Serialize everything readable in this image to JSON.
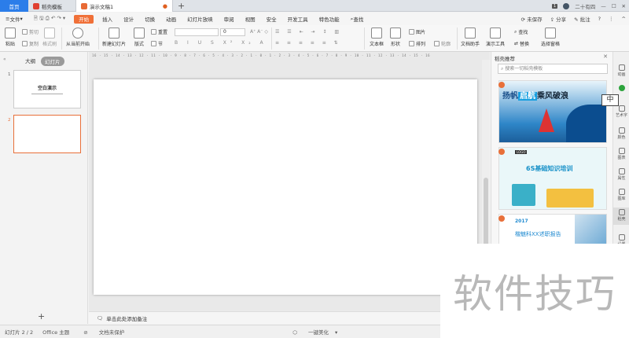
{
  "titlebar": {
    "home": "首页",
    "tab1": "稻壳模板",
    "tab2": "演示文稿1",
    "badge": "1",
    "user": "二十有四",
    "colors": {
      "home": "#2b7de9",
      "active": "#f07038"
    }
  },
  "menubar": {
    "file": "文件",
    "items": [
      "开始",
      "插入",
      "设计",
      "切换",
      "动画",
      "幻灯片放映",
      "审阅",
      "视图",
      "安全",
      "开发工具",
      "特色功能"
    ],
    "search": "查找",
    "unsaved": "未保存",
    "share": "分享",
    "batch": "批注"
  },
  "ribbon": {
    "paste": "粘贴",
    "cut": "剪切",
    "copy": "复制",
    "format": "格式刷",
    "from_start": "从当前开始",
    "new_slide": "新建幻灯片",
    "layout": "版式",
    "reset": "重置",
    "section": "节",
    "font_size": "0",
    "textbox": "文本框",
    "shape": "形状",
    "picture": "图片",
    "arrange": "排列",
    "outline": "轮廓",
    "doc_helper": "文档助手",
    "slide_tools": "演示工具",
    "find": "查找",
    "replace": "替换",
    "select_pane": "选择窗格"
  },
  "leftpanel": {
    "tab_outline": "大纲",
    "tab_slides": "幻灯片",
    "slide1_num": "1",
    "slide1_title": "空白演示",
    "slide2_num": "2",
    "add": "+"
  },
  "canvas": {
    "ruler": "16 · 15 · 14 · 13 · 12 · 11 · 10 · 9 · 8 · 7 · 6 · 5 · 4 · 3 · 2 · 1 · 0 · 1 · 2 · 3 · 4 · 5 · 6 · 7 · 8 · 9 · 10 · 11 · 12 · 13 · 14 · 15 · 16",
    "notes": "单击此处添加备注"
  },
  "rightpanel": {
    "title": "稻壳推荐",
    "search_placeholder": "搜索一切稻壳模板",
    "tpl1_text1": "扬帆",
    "tpl1_text2": "启航",
    "tpl1_text3": "乘风破浪",
    "tpl2_logo": "LOGO",
    "tpl2_title": "6S基础知识培训",
    "tpl3_year": "2017",
    "tpl3_title": "楷魅科XX述职报告"
  },
  "sidebar": {
    "items": [
      "动画",
      "",
      "艺术字",
      "颜色",
      "图表",
      "属性",
      "图库",
      "稻壳",
      "设置"
    ]
  },
  "ime": "中",
  "statusbar": {
    "slide_count": "幻灯片 2 / 2",
    "theme": "Office 主题",
    "protect": "文档未保护",
    "beautify": "一键美化"
  },
  "watermark": "软件技巧"
}
